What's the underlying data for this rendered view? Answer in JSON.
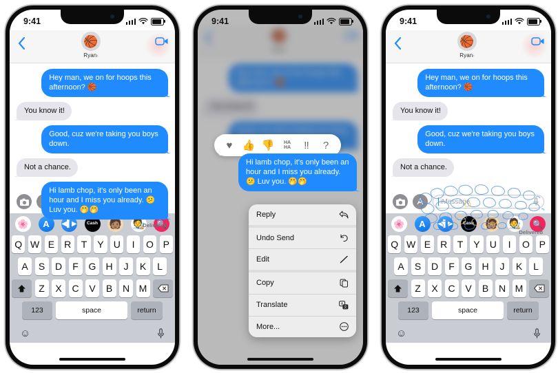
{
  "page": {
    "background": "#ffffff"
  },
  "colors": {
    "bubble_out": "#1f8bff",
    "bubble_in": "#e6e5eb",
    "accent_blue": "#1f8bff",
    "keyboard_bg": "#c9ccd2"
  },
  "status_bar": {
    "time": "9:41",
    "signal_icon": "cellular-bars-icon",
    "wifi_icon": "wifi-icon",
    "battery_icon": "battery-icon"
  },
  "header": {
    "back_icon": "back-chevron-icon",
    "avatar_emoji": "🏀",
    "contact_name": "Ryan",
    "disclosure": "›",
    "facetime_icon": "facetime-video-icon"
  },
  "conversation": {
    "messages": [
      {
        "side": "out",
        "text": "Hey man, we on for hoops this afternoon? 🏀"
      },
      {
        "side": "in",
        "text": "You know it!"
      },
      {
        "side": "out",
        "text": "Good, cuz we're taking you boys down."
      },
      {
        "side": "in",
        "text": "Not a chance."
      },
      {
        "side": "out",
        "text": "Hi lamb chop, it's only been an hour and I miss you already. 😕 Luv you. 🤭🤭"
      }
    ],
    "delivered_label": "Delivered"
  },
  "input_bar": {
    "camera_icon": "camera-icon",
    "apps_icon": "app-store-icon",
    "placeholder": "iMessage",
    "mic_icon": "microphone-icon"
  },
  "app_drawer": {
    "apps": [
      {
        "name": "photos-app-icon",
        "glyph": "🌸"
      },
      {
        "name": "app-store-app-icon",
        "glyph": "A"
      },
      {
        "name": "audio-message-app-icon",
        "glyph": "◀▌▶"
      },
      {
        "name": "apple-cash-app-icon",
        "glyph": "Cash"
      },
      {
        "name": "memoji-app-icon",
        "glyph": "🧑🏽"
      },
      {
        "name": "memoji-sticker-app-icon",
        "glyph": "🧑‍🎨"
      },
      {
        "name": "images-search-app-icon",
        "glyph": "🔍"
      }
    ]
  },
  "keyboard": {
    "row1": [
      "Q",
      "W",
      "E",
      "R",
      "T",
      "Y",
      "U",
      "I",
      "O",
      "P"
    ],
    "row2": [
      "A",
      "S",
      "D",
      "F",
      "G",
      "H",
      "J",
      "K",
      "L"
    ],
    "row3": [
      "Z",
      "X",
      "C",
      "V",
      "B",
      "N",
      "M"
    ],
    "shift_icon": "shift-arrow-icon",
    "backspace_icon": "backspace-icon",
    "numbers_key": "123",
    "space_key": "space",
    "return_key": "return",
    "emoji_icon": "emoji-smiley-icon",
    "dictation_icon": "microphone-icon"
  },
  "tapbacks": {
    "items": [
      {
        "name": "tapback-heart",
        "glyph": "♥"
      },
      {
        "name": "tapback-thumbs-up",
        "glyph": "👍"
      },
      {
        "name": "tapback-thumbs-down",
        "glyph": "👎"
      },
      {
        "name": "tapback-haha",
        "glyph": "HA\nHA"
      },
      {
        "name": "tapback-exclamation",
        "glyph": "‼"
      },
      {
        "name": "tapback-question",
        "glyph": "?"
      }
    ]
  },
  "context_menu": {
    "items": [
      {
        "label": "Reply",
        "icon": "reply-arrow-icon"
      },
      {
        "label": "Undo Send",
        "icon": "undo-arrow-icon"
      },
      {
        "label": "Edit",
        "icon": "pencil-icon"
      },
      {
        "label": "Copy",
        "icon": "copy-icon"
      },
      {
        "label": "Translate",
        "icon": "translate-icon"
      },
      {
        "label": "More...",
        "icon": "ellipsis-circle-icon"
      }
    ]
  },
  "unsent": {
    "state_label": "message-disintegrating"
  }
}
